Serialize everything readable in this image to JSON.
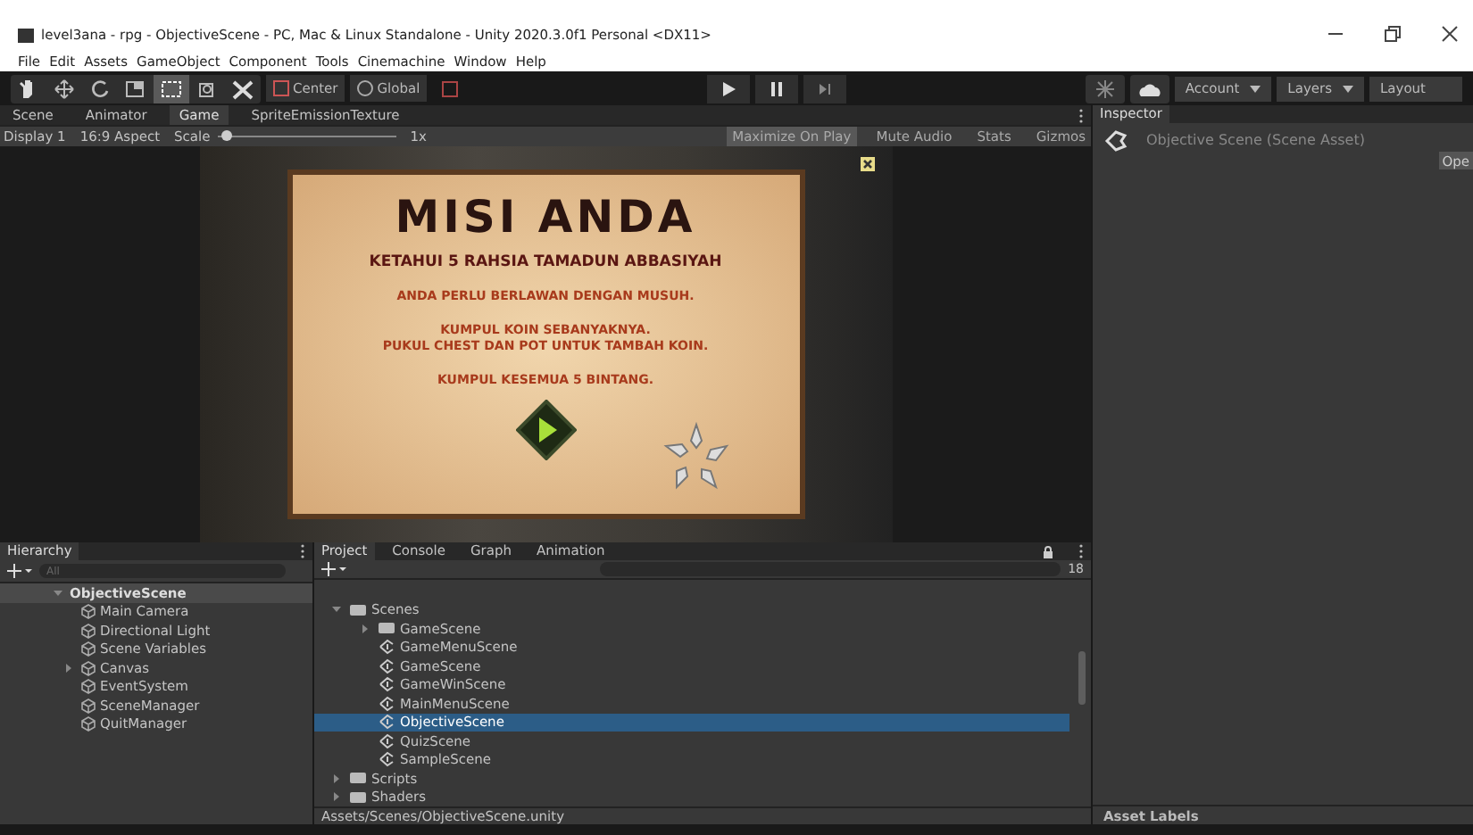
{
  "window": {
    "title": "level3ana - rpg - ObjectiveScene - PC, Mac & Linux Standalone - Unity 2020.3.0f1 Personal <DX11>"
  },
  "menu": [
    "File",
    "Edit",
    "Assets",
    "GameObject",
    "Component",
    "Tools",
    "Cinemachine",
    "Window",
    "Help"
  ],
  "toolbar": {
    "pivot": "Center",
    "space": "Global",
    "account": "Account",
    "layers": "Layers",
    "layout": "Layout"
  },
  "view_tabs": [
    {
      "label": "Scene",
      "selected": false
    },
    {
      "label": "Animator",
      "selected": false
    },
    {
      "label": "Game",
      "selected": true
    },
    {
      "label": "SpriteEmissionTexture",
      "selected": false
    }
  ],
  "game_toolbar": {
    "display": "Display 1",
    "aspect": "16:9 Aspect",
    "scale_label": "Scale",
    "scale": {
      "level": 0.05
    },
    "scale_value": "1x",
    "options": [
      {
        "label": "Maximize On Play",
        "on": true
      },
      {
        "label": "Mute Audio",
        "on": false
      },
      {
        "label": "Stats",
        "on": false
      },
      {
        "label": "Gizmos",
        "on": false
      }
    ]
  },
  "game": {
    "title": "MISI ANDA",
    "subtitle": "KETAHUI 5 RAHSIA TAMADUN ABBASIYAH",
    "lines": [
      "ANDA PERLU BERLAWAN DENGAN MUSUH.",
      "KUMPUL KOIN SEBANYAKNYA.\nPUKUL CHEST DAN POT UNTUK TAMBAH KOIN.",
      "KUMPUL KESEMUA 5 BINTANG."
    ]
  },
  "inspector": {
    "tab": "Inspector",
    "asset": "Objective Scene (Scene Asset)",
    "open_button": "Ope",
    "footer": "Asset Labels"
  },
  "hierarchy": {
    "tab": "Hierarchy",
    "search_placeholder": "All",
    "root": {
      "label": "ObjectiveScene",
      "expanded": true,
      "children": [
        {
          "label": "Main Camera"
        },
        {
          "label": "Directional Light"
        },
        {
          "label": "Scene Variables"
        },
        {
          "label": "Canvas",
          "expanded": false
        },
        {
          "label": "EventSystem"
        },
        {
          "label": "SceneManager"
        },
        {
          "label": "QuitManager"
        }
      ]
    }
  },
  "project": {
    "tabs": [
      {
        "label": "Project",
        "selected": true
      },
      {
        "label": "Console",
        "selected": false
      },
      {
        "label": "Graph",
        "selected": false
      },
      {
        "label": "Animation",
        "selected": false
      }
    ],
    "hidden_count": "18",
    "tree": [
      {
        "kind": "folder",
        "label": "Scenes",
        "expanded": true,
        "selected": false,
        "children": [
          {
            "kind": "folder",
            "label": "GameScene",
            "expanded": false,
            "selected": false
          },
          {
            "kind": "scene",
            "label": "GameMenuScene",
            "selected": false
          },
          {
            "kind": "scene",
            "label": "GameScene",
            "selected": false
          },
          {
            "kind": "scene",
            "label": "GameWinScene",
            "selected": false
          },
          {
            "kind": "scene",
            "label": "MainMenuScene",
            "selected": false
          },
          {
            "kind": "scene",
            "label": "ObjectiveScene",
            "selected": true
          },
          {
            "kind": "scene",
            "label": "QuizScene",
            "selected": false
          },
          {
            "kind": "scene",
            "label": "SampleScene",
            "selected": false
          }
        ]
      },
      {
        "kind": "folder",
        "label": "Scripts",
        "expanded": false,
        "selected": false
      },
      {
        "kind": "folder",
        "label": "Shaders",
        "expanded": false,
        "selected": false
      }
    ],
    "path": "Assets/Scenes/ObjectiveScene.unity"
  }
}
